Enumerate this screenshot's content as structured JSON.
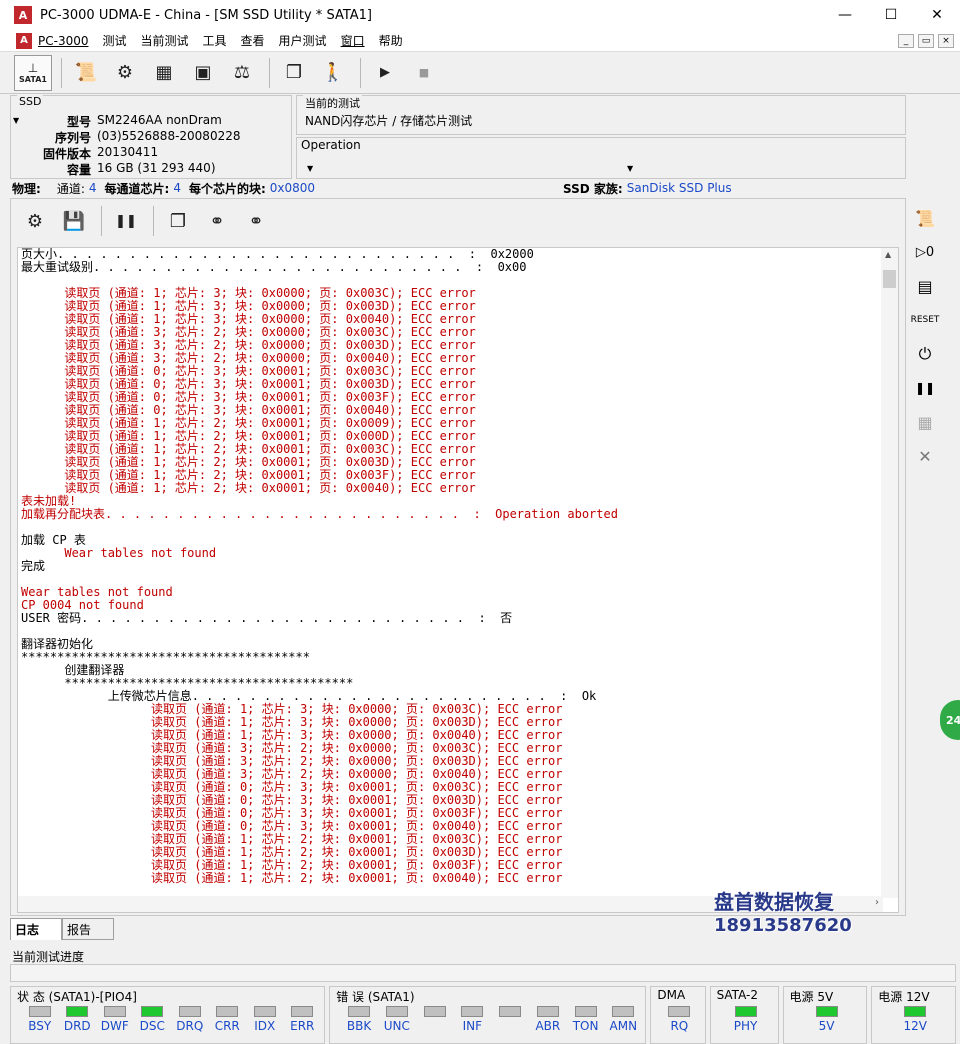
{
  "window": {
    "title": "PC-3000 UDMA-E - China - [SM SSD Utility * SATA1]",
    "app_icon_text": "A",
    "min": "—",
    "max": "☐",
    "close": "✕"
  },
  "menubar": {
    "items": [
      "PC-3000",
      "测试",
      "当前测试",
      "工具",
      "查看",
      "用户测试",
      "窗口",
      "帮助"
    ],
    "mdi": [
      "_",
      "▭",
      "×"
    ]
  },
  "toolbar": {
    "sata_label": "SATA1",
    "icons": [
      "port-icon",
      "script-icon",
      "gear-chip-icon",
      "chips-icon",
      "board-icon",
      "scale-icon",
      "copy-icon",
      "walk-icon",
      "play-icon",
      "stop-icon"
    ]
  },
  "ssd": {
    "box_title": "SSD",
    "rows": [
      {
        "k": "型号",
        "v": "SM2246AA nonDram"
      },
      {
        "k": "序列号",
        "v": "(03)5526888-20080228"
      },
      {
        "k": "固件版本",
        "v": "20130411"
      },
      {
        "k": "容量",
        "v": "16 GB (31 293 440)"
      }
    ]
  },
  "current_test": {
    "title": "当前的测试",
    "value": "NAND闪存芯片 / 存储芯片测试"
  },
  "operation": {
    "title": "Operation"
  },
  "physical": {
    "label": "物理:",
    "channels_label": "通道:",
    "channels": "4",
    "chips_label": "每通道芯片:",
    "chips": "4",
    "blocks_label": "每个芯片的块:",
    "blocks": "0x0800",
    "family_label": "SSD 家族:",
    "family": "SanDisk SSD Plus"
  },
  "log": {
    "lines": [
      {
        "t": "页大小. . . . . . . . . . . . . . . . . . . . . . . . . . . .  :  0x2000",
        "c": "k"
      },
      {
        "t": "最大重试级别. . . . . . . . . . . . . . . . . . . . . . . . . .  :  0x00",
        "c": "k"
      },
      {
        "t": "",
        "c": "k"
      },
      {
        "t": "      读取页 (通道: 1; 芯片: 3; 块: 0x0000; 页: 0x003C); ECC error",
        "c": "r"
      },
      {
        "t": "      读取页 (通道: 1; 芯片: 3; 块: 0x0000; 页: 0x003D); ECC error",
        "c": "r"
      },
      {
        "t": "      读取页 (通道: 1; 芯片: 3; 块: 0x0000; 页: 0x0040); ECC error",
        "c": "r"
      },
      {
        "t": "      读取页 (通道: 3; 芯片: 2; 块: 0x0000; 页: 0x003C); ECC error",
        "c": "r"
      },
      {
        "t": "      读取页 (通道: 3; 芯片: 2; 块: 0x0000; 页: 0x003D); ECC error",
        "c": "r"
      },
      {
        "t": "      读取页 (通道: 3; 芯片: 2; 块: 0x0000; 页: 0x0040); ECC error",
        "c": "r"
      },
      {
        "t": "      读取页 (通道: 0; 芯片: 3; 块: 0x0001; 页: 0x003C); ECC error",
        "c": "r"
      },
      {
        "t": "      读取页 (通道: 0; 芯片: 3; 块: 0x0001; 页: 0x003D); ECC error",
        "c": "r"
      },
      {
        "t": "      读取页 (通道: 0; 芯片: 3; 块: 0x0001; 页: 0x003F); ECC error",
        "c": "r"
      },
      {
        "t": "      读取页 (通道: 0; 芯片: 3; 块: 0x0001; 页: 0x0040); ECC error",
        "c": "r"
      },
      {
        "t": "      读取页 (通道: 1; 芯片: 2; 块: 0x0001; 页: 0x0009); ECC error",
        "c": "r"
      },
      {
        "t": "      读取页 (通道: 1; 芯片: 2; 块: 0x0001; 页: 0x000D); ECC error",
        "c": "r"
      },
      {
        "t": "      读取页 (通道: 1; 芯片: 2; 块: 0x0001; 页: 0x003C); ECC error",
        "c": "r"
      },
      {
        "t": "      读取页 (通道: 1; 芯片: 2; 块: 0x0001; 页: 0x003D); ECC error",
        "c": "r"
      },
      {
        "t": "      读取页 (通道: 1; 芯片: 2; 块: 0x0001; 页: 0x003F); ECC error",
        "c": "r"
      },
      {
        "t": "      读取页 (通道: 1; 芯片: 2; 块: 0x0001; 页: 0x0040); ECC error",
        "c": "r"
      },
      {
        "t": "表未加载!",
        "c": "r"
      },
      {
        "t": "加载再分配块表. . . . . . . . . . . . . . . . . . . . . . . . .  :  Operation aborted",
        "c": "r"
      },
      {
        "t": "",
        "c": "k"
      },
      {
        "t": "加载 CP 表",
        "c": "k"
      },
      {
        "t": "      Wear tables not found",
        "c": "r"
      },
      {
        "t": "完成",
        "c": "k"
      },
      {
        "t": "",
        "c": "k"
      },
      {
        "t": "Wear tables not found",
        "c": "r"
      },
      {
        "t": "CP 0004 not found",
        "c": "r"
      },
      {
        "t": "USER 密码. . . . . . . . . . . . . . . . . . . . . . . . . . .  :  否",
        "c": "k"
      },
      {
        "t": "",
        "c": "k"
      },
      {
        "t": "翻译器初始化",
        "c": "k"
      },
      {
        "t": "****************************************",
        "c": "k"
      },
      {
        "t": "      创建翻译器",
        "c": "k"
      },
      {
        "t": "      ****************************************",
        "c": "k"
      },
      {
        "t": "            上传微芯片信息. . . . . . . . . . . . . . . . . . . . . . . . .  :  Ok",
        "c": "k"
      },
      {
        "t": "                  读取页 (通道: 1; 芯片: 3; 块: 0x0000; 页: 0x003C); ECC error",
        "c": "r"
      },
      {
        "t": "                  读取页 (通道: 1; 芯片: 3; 块: 0x0000; 页: 0x003D); ECC error",
        "c": "r"
      },
      {
        "t": "                  读取页 (通道: 1; 芯片: 3; 块: 0x0000; 页: 0x0040); ECC error",
        "c": "r"
      },
      {
        "t": "                  读取页 (通道: 3; 芯片: 2; 块: 0x0000; 页: 0x003C); ECC error",
        "c": "r"
      },
      {
        "t": "                  读取页 (通道: 3; 芯片: 2; 块: 0x0000; 页: 0x003D); ECC error",
        "c": "r"
      },
      {
        "t": "                  读取页 (通道: 3; 芯片: 2; 块: 0x0000; 页: 0x0040); ECC error",
        "c": "r"
      },
      {
        "t": "                  读取页 (通道: 0; 芯片: 3; 块: 0x0001; 页: 0x003C); ECC error",
        "c": "r"
      },
      {
        "t": "                  读取页 (通道: 0; 芯片: 3; 块: 0x0001; 页: 0x003D); ECC error",
        "c": "r"
      },
      {
        "t": "                  读取页 (通道: 0; 芯片: 3; 块: 0x0001; 页: 0x003F); ECC error",
        "c": "r"
      },
      {
        "t": "                  读取页 (通道: 0; 芯片: 3; 块: 0x0001; 页: 0x0040); ECC error",
        "c": "r"
      },
      {
        "t": "                  读取页 (通道: 1; 芯片: 2; 块: 0x0001; 页: 0x003C); ECC error",
        "c": "r"
      },
      {
        "t": "                  读取页 (通道: 1; 芯片: 2; 块: 0x0001; 页: 0x003D); ECC error",
        "c": "r"
      },
      {
        "t": "                  读取页 (通道: 1; 芯片: 2; 块: 0x0001; 页: 0x003F); ECC error",
        "c": "r"
      },
      {
        "t": "                  读取页 (通道: 1; 芯片: 2; 块: 0x0001; 页: 0x0040); ECC error",
        "c": "r"
      }
    ]
  },
  "watermark": {
    "line1": "盘首数据恢复",
    "line2": "18913587620"
  },
  "side_badge": "24",
  "tabs": [
    {
      "label": "日志",
      "active": true
    },
    {
      "label": "报告",
      "active": false
    }
  ],
  "progress": {
    "label": "当前测试进度"
  },
  "status": {
    "groups": [
      {
        "title": "状 态 (SATA1)-[PIO4]",
        "leds": [
          {
            "l": "BSY",
            "on": false
          },
          {
            "l": "DRD",
            "on": true
          },
          {
            "l": "DWF",
            "on": false
          },
          {
            "l": "DSC",
            "on": true
          },
          {
            "l": "DRQ",
            "on": false
          },
          {
            "l": "CRR",
            "on": false
          },
          {
            "l": "IDX",
            "on": false
          },
          {
            "l": "ERR",
            "on": false
          }
        ]
      },
      {
        "title": "错 误 (SATA1)",
        "leds": [
          {
            "l": "BBK",
            "on": false
          },
          {
            "l": "UNC",
            "on": false
          },
          {
            "l": "",
            "on": false
          },
          {
            "l": "INF",
            "on": false
          },
          {
            "l": "",
            "on": false
          },
          {
            "l": "ABR",
            "on": false
          },
          {
            "l": "TON",
            "on": false
          },
          {
            "l": "AMN",
            "on": false
          }
        ]
      },
      {
        "title": "DMA",
        "leds": [
          {
            "l": "RQ",
            "on": false
          }
        ]
      },
      {
        "title": "SATA-2",
        "leds": [
          {
            "l": "PHY",
            "on": true
          }
        ]
      },
      {
        "title": "电源 5V",
        "leds": [
          {
            "l": "5V",
            "on": true
          }
        ]
      },
      {
        "title": "电源 12V",
        "leds": [
          {
            "l": "12V",
            "on": true
          }
        ]
      }
    ]
  },
  "colors": {
    "error_red": "#c00000",
    "value_blue": "#1b4ac8",
    "led_on": "#1fc82f"
  }
}
